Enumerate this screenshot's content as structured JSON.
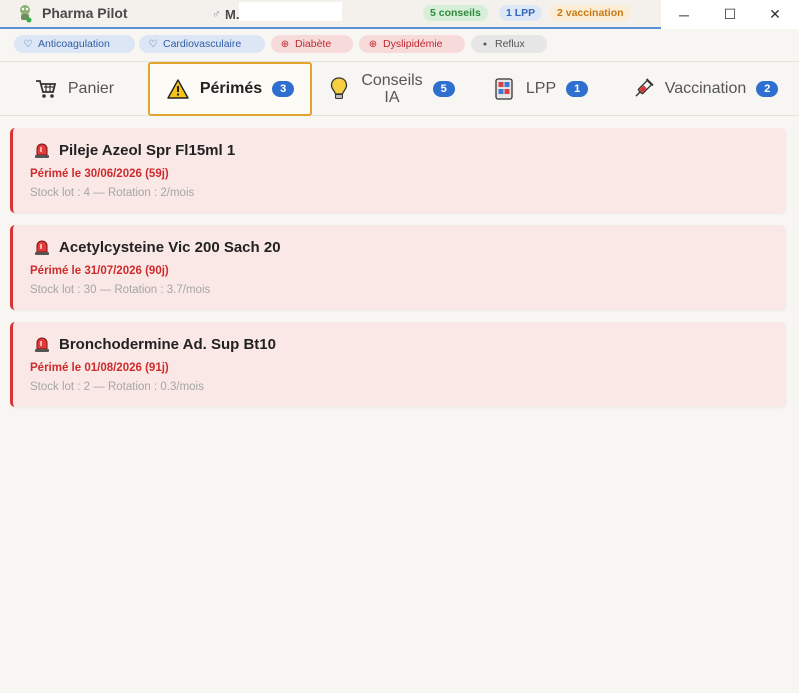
{
  "app": {
    "title": "Pharma Pilot",
    "patient_gender_icon": "male-symbol-icon",
    "patient_name": "M."
  },
  "header_badges": [
    {
      "label": "5 conseils",
      "color": "#2f8a3c"
    },
    {
      "label": "1 LPP",
      "color": "#3667b8"
    },
    {
      "label": "2 vaccination",
      "color": "#c77a14"
    }
  ],
  "window_controls": {
    "minimize": "─",
    "maximize": "☐",
    "close": "✕"
  },
  "tags": [
    {
      "label": "Anticoagulation",
      "icon": "heart-outline-icon",
      "glyph": "♡",
      "color": "blue"
    },
    {
      "label": "Cardiovasculaire",
      "icon": "heart-outline-icon",
      "glyph": "♡",
      "color": "blue"
    },
    {
      "label": "Diabète",
      "icon": "plus-circle-icon",
      "glyph": "⊕",
      "color": "red"
    },
    {
      "label": "Dyslipidémie",
      "icon": "plus-circle-icon",
      "glyph": "⊕",
      "color": "red"
    },
    {
      "label": "Reflux",
      "icon": "dot-icon",
      "glyph": "●",
      "color": "grey"
    }
  ],
  "tabs": [
    {
      "label": "Panier",
      "icon": "cart-icon",
      "count": null,
      "active": false
    },
    {
      "label": "Périmés",
      "icon": "warning-icon",
      "count": "3",
      "active": true
    },
    {
      "label_line1": "Conseils",
      "label_line2": "IA",
      "icon": "lightbulb-icon",
      "count": "5",
      "active": false
    },
    {
      "label": "LPP",
      "icon": "device-icon",
      "count": "1",
      "active": false
    },
    {
      "label": "Vaccination",
      "icon": "syringe-icon",
      "count": "2",
      "active": false
    }
  ],
  "expired_items": [
    {
      "name": "Pileje Azeol Spr Fl15ml 1",
      "expiry": "Périmé le 30/06/2026 (59j)",
      "stock": "Stock lot : 4 — Rotation : 2/mois"
    },
    {
      "name": "Acetylcysteine Vic 200 Sach 20",
      "expiry": "Périmé le 31/07/2026 (90j)",
      "stock": "Stock lot : 30 — Rotation : 3.7/mois"
    },
    {
      "name": "Bronchodermine Ad. Sup Bt10",
      "expiry": "Périmé le 01/08/2026 (91j)",
      "stock": "Stock lot : 2 — Rotation : 0.3/mois"
    }
  ],
  "colors": {
    "accent": "#2f6fd0",
    "active_tab_border": "#e2a42c",
    "alert": "#d93434"
  }
}
